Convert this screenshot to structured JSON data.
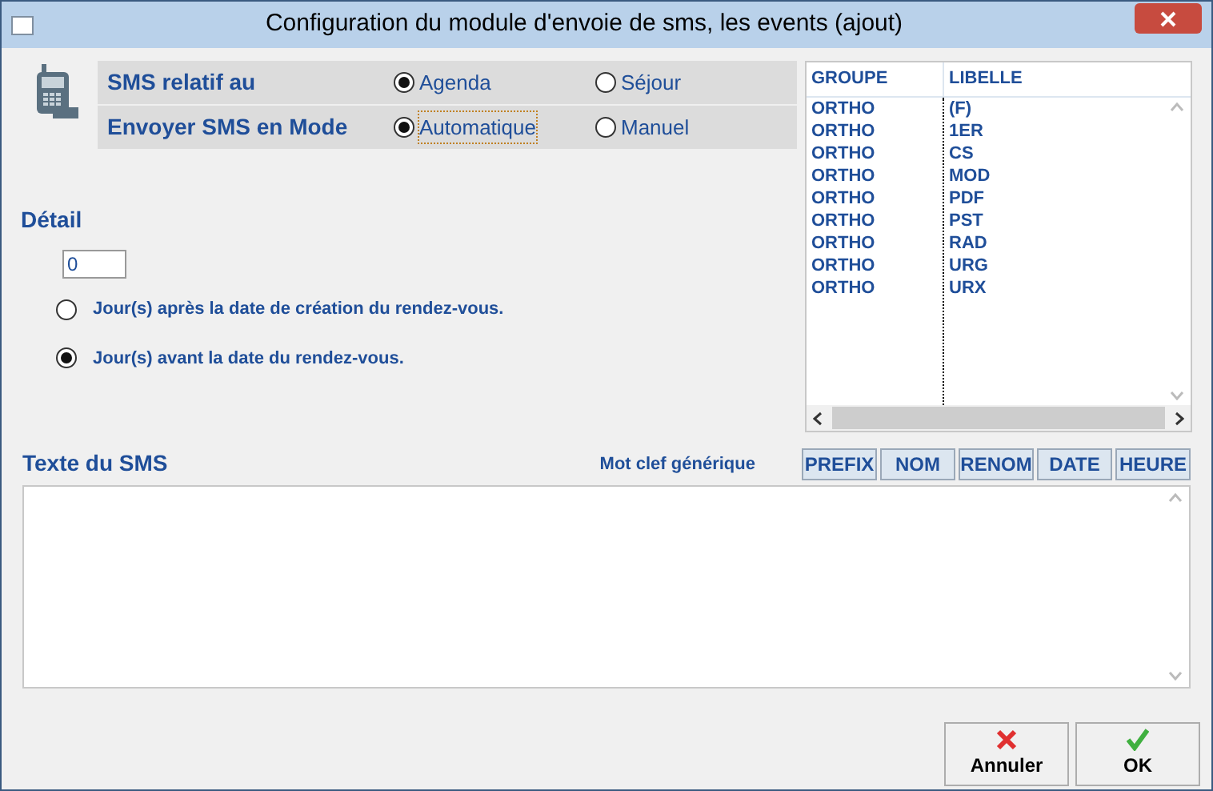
{
  "window": {
    "title": "Configuration du module d'envoie de sms, les events (ajout)"
  },
  "option_groups": [
    {
      "label": "SMS relatif au",
      "options": [
        {
          "label": "Agenda",
          "selected": true,
          "focused": false
        },
        {
          "label": "Séjour",
          "selected": false,
          "focused": false
        }
      ]
    },
    {
      "label": "Envoyer SMS en Mode",
      "options": [
        {
          "label": "Automatique",
          "selected": true,
          "focused": true
        },
        {
          "label": "Manuel",
          "selected": false,
          "focused": false
        }
      ]
    }
  ],
  "detail": {
    "label": "Détail",
    "value": "0",
    "options": [
      {
        "label": "Jour(s) après la date de création du rendez-vous.",
        "selected": false
      },
      {
        "label": "Jour(s) avant la date du rendez-vous.",
        "selected": true
      }
    ]
  },
  "table": {
    "columns": [
      "GROUPE",
      "LIBELLE"
    ],
    "rows": [
      [
        "ORTHO",
        "(F)"
      ],
      [
        "ORTHO",
        "1ER"
      ],
      [
        "ORTHO",
        "CS"
      ],
      [
        "ORTHO",
        "MOD"
      ],
      [
        "ORTHO",
        "PDF"
      ],
      [
        "ORTHO",
        "PST"
      ],
      [
        "ORTHO",
        "RAD"
      ],
      [
        "ORTHO",
        "URG"
      ],
      [
        "ORTHO",
        "URX"
      ]
    ]
  },
  "sms_text": {
    "label": "Texte du SMS"
  },
  "keywords": {
    "label": "Mot clef générique",
    "buttons": [
      "PREFIX",
      "NOM",
      "RENOM",
      "DATE",
      "HEURE"
    ]
  },
  "footer_buttons": [
    {
      "kind": "cancel",
      "label": "Annuler"
    },
    {
      "kind": "ok",
      "label": "OK"
    }
  ]
}
